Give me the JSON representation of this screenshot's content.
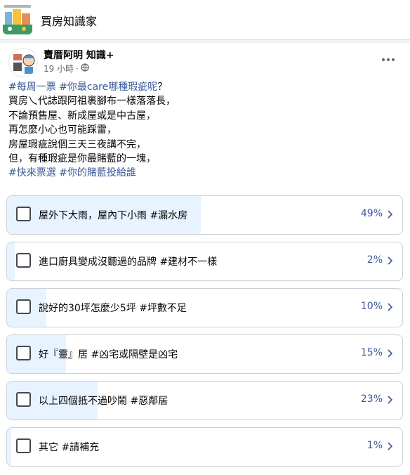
{
  "group": {
    "name": "買房知識家",
    "logo_icon": "group-logo-icon"
  },
  "post": {
    "author": "賣厝阿明 知識+",
    "time": "19 小時",
    "privacy_icon": "globe-icon",
    "text_lines": [
      [
        {
          "t": "#每周一票 #你最care哪種瑕疵呢",
          "tag": true
        },
        {
          "t": "？",
          "tag": false
        }
      ],
      [
        {
          "t": "買房乀代誌跟阿祖裹腳布一樣落落長，",
          "tag": false
        }
      ],
      [
        {
          "t": "不論預售屋、新成屋或是中古屋，",
          "tag": false
        }
      ],
      [
        {
          "t": "再怎麼小心也可能踩雷，",
          "tag": false
        }
      ],
      [
        {
          "t": "房屋瑕疵說個三天三夜講不完，",
          "tag": false
        }
      ],
      [
        {
          "t": "但，有種瑕疵是你最賭藍的一塊，",
          "tag": false
        }
      ],
      [
        {
          "t": "#快來票選 #你的賭藍投給誰",
          "tag": true
        }
      ]
    ]
  },
  "poll": {
    "options": [
      {
        "label": "屋外下大雨，屋內下小雨 #漏水房",
        "percent_text": "49%",
        "fraction": 0.49
      },
      {
        "label": "進口廚具變成沒聽過的品牌 #建材不一樣",
        "percent_text": "2%",
        "fraction": 0.02
      },
      {
        "label": "說好的30坪怎麼少5坪 #坪數不足",
        "percent_text": "10%",
        "fraction": 0.1
      },
      {
        "label": "好『靈』居 #凶宅或隔壁是凶宅",
        "percent_text": "15%",
        "fraction": 0.15
      },
      {
        "label": "以上四個抵不過吵鬧 #惡鄰居",
        "percent_text": "23%",
        "fraction": 0.23
      },
      {
        "label": "其它 #請補充",
        "percent_text": "1%",
        "fraction": 0.01
      }
    ]
  },
  "colors": {
    "accent": "#385898",
    "poll_fill": "#e7f3ff",
    "border": "#ccd0d5"
  }
}
